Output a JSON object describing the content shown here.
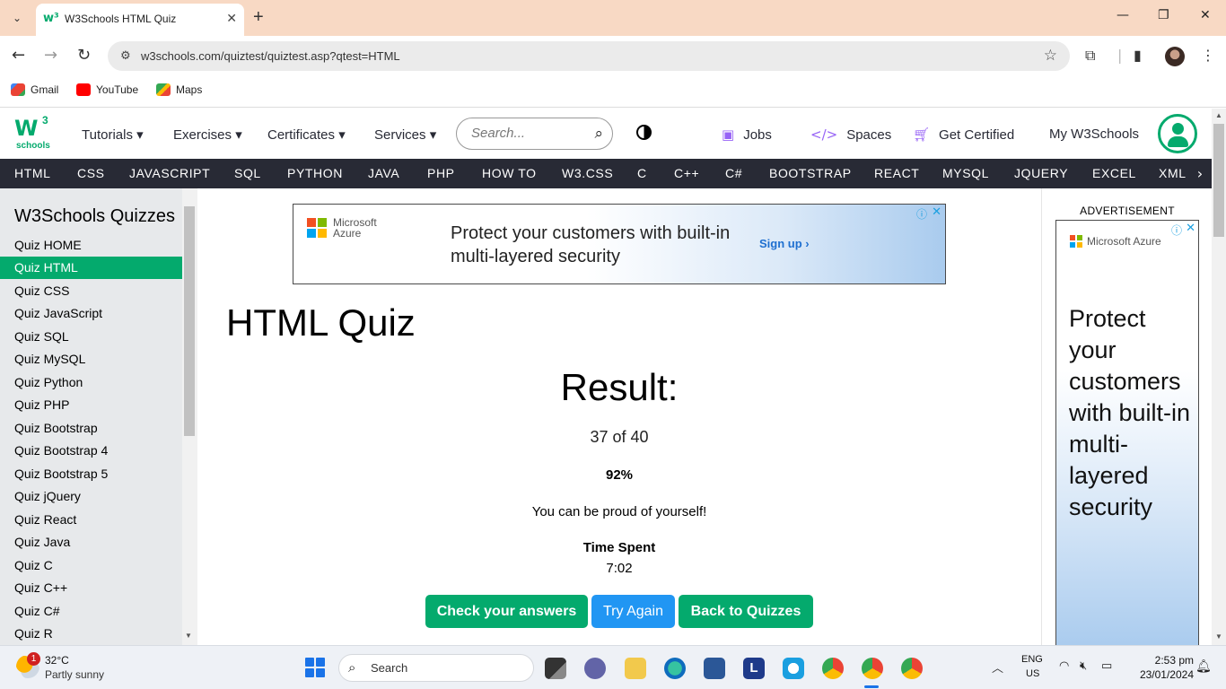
{
  "browser": {
    "tab_title": "W3Schools HTML Quiz",
    "url": "w3schools.com/quiztest/quiztest.asp?qtest=HTML",
    "bookmarks": [
      {
        "label": "Gmail",
        "icon": "gmail-icon",
        "color": "#d93025"
      },
      {
        "label": "YouTube",
        "icon": "youtube-icon",
        "color": "#ff0000"
      },
      {
        "label": "Maps",
        "icon": "maps-icon",
        "color": "#34a853"
      }
    ]
  },
  "w3nav": {
    "logo_mark": "W",
    "logo_sup": "3",
    "logo_text": "schools",
    "menu": [
      "Tutorials",
      "Exercises",
      "Certificates",
      "Services"
    ],
    "search_placeholder": "Search...",
    "right_links": [
      "Jobs",
      "Spaces",
      "Get Certified",
      "My W3Schools"
    ],
    "subnav": [
      "HTML",
      "CSS",
      "JAVASCRIPT",
      "SQL",
      "PYTHON",
      "JAVA",
      "PHP",
      "HOW TO",
      "W3.CSS",
      "C",
      "C++",
      "C#",
      "BOOTSTRAP",
      "REACT",
      "MYSQL",
      "JQUERY",
      "EXCEL",
      "XML"
    ],
    "accent_color": "#04aa6d",
    "dark_color": "#282a35"
  },
  "sidebar": {
    "title": "W3Schools Quizzes",
    "items": [
      "Quiz HOME",
      "Quiz HTML",
      "Quiz CSS",
      "Quiz JavaScript",
      "Quiz SQL",
      "Quiz MySQL",
      "Quiz Python",
      "Quiz PHP",
      "Quiz Bootstrap",
      "Quiz Bootstrap 4",
      "Quiz Bootstrap 5",
      "Quiz jQuery",
      "Quiz React",
      "Quiz Java",
      "Quiz C",
      "Quiz C++",
      "Quiz C#",
      "Quiz R"
    ],
    "active": "Quiz HTML"
  },
  "ad_banner": {
    "brand_line1": "Microsoft",
    "brand_line2": "Azure",
    "headline": "Protect your customers with built-in multi-layered security",
    "cta": "Sign up ›"
  },
  "main": {
    "page_title": "HTML Quiz",
    "result_heading": "Result:",
    "score": "37 of 40",
    "percent": "92%",
    "message": "You can be proud of yourself!",
    "time_label": "Time Spent",
    "time_value": "7:02",
    "buttons": {
      "check": "Check your answers",
      "again": "Try Again",
      "back": "Back to Quizzes"
    }
  },
  "side_ad": {
    "label": "ADVERTISEMENT",
    "brand": "Microsoft Azure",
    "headline": "Protect your customers with built-in multi-layered security"
  },
  "taskbar": {
    "weather_temp": "32°C",
    "weather_desc": "Partly sunny",
    "weather_badge": "1",
    "search_label": "Search",
    "lang_top": "ENG",
    "lang_bottom": "US",
    "time": "2:53 pm",
    "date": "23/01/2024"
  }
}
